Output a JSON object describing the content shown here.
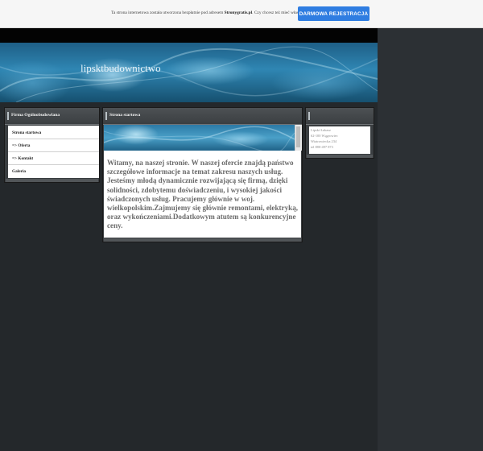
{
  "top_bar": {
    "notice_prefix": "Ta strona internetowa została utworzona bezpłatnie pod adresem",
    "notice_link": "Stronygratis.pl",
    "notice_suffix": ". Czy chcesz też mieć własną stronę?",
    "register_button": "DARMOWA REJESTRACJA"
  },
  "header": {
    "site_title": "lipsktbudownictwo"
  },
  "left_panel": {
    "title": "Firma Ogólnobudowlana",
    "menu": [
      {
        "label": "Strona startowa"
      },
      {
        "label": "=> Oferta"
      },
      {
        "label": "=> Kontakt"
      },
      {
        "label": "Galeria"
      }
    ]
  },
  "center_panel": {
    "title": "Strona startowa",
    "welcome_text": "Witamy, na naszej stronie. W naszej ofercie znajdą państwo szczegółowe informacje na temat zakresu naszych usług. Jesteśmy młodą dynamicznie rozwijającą się firmą, dzięki solidności, zdobytemu doświadczeniu, i wysokiej jakości świadczonych usług. Pracujemy głównie w woj. wielkopolskim.Zajmujemy się głównie remontami, elektryką, oraz wykończeniami.Dodatkowym atutem są konkurencyjne ceny."
  },
  "right_panel": {
    "contact_lines": [
      "Lipski Łukasz",
      "62-100 Wągrowiec",
      "Wiatrowiecka 234",
      "tel 880-497 873"
    ]
  }
}
